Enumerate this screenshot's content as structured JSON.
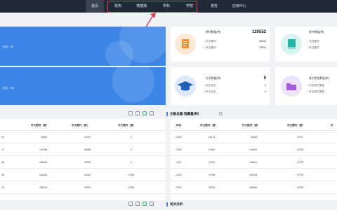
{
  "nav": {
    "items": [
      "首页",
      "机构",
      "数据库",
      "学科",
      "学院",
      "报告",
      "应用中心"
    ],
    "active_index": 0
  },
  "banners": [
    {
      "line": "外文：99"
    },
    {
      "line": "外文：387"
    }
  ],
  "cards": [
    {
      "title": "期刊数量(种)",
      "total": "120552",
      "rows": [
        {
          "label": "• 中文期刊",
          "value": "40933"
        },
        {
          "label": "• 外文期刊",
          "value": "79619"
        }
      ],
      "icon": "book-icon",
      "color": "#fde9d6"
    },
    {
      "title": "图书数量(种)",
      "total": "",
      "rows": [
        {
          "label": "• 中文图书",
          "value": ""
        },
        {
          "label": "• 外文图书",
          "value": ""
        }
      ],
      "icon": "book-closed-icon",
      "color": "#d8f3f0"
    },
    {
      "title": "论文数量(种)",
      "total": "0",
      "rows": [
        {
          "label": "• 中文论文",
          "value": "0"
        },
        {
          "label": "• 外文论文",
          "value": "0"
        }
      ],
      "icon": "graduation-cap-icon",
      "color": "#dce9fb"
    },
    {
      "title": "其它类型数量(种)",
      "total": "",
      "rows": [
        {
          "label": "• 中文其它类型",
          "value": ""
        },
        {
          "label": "• 外文其它类型",
          "value": ""
        }
      ],
      "icon": "folder-icon",
      "color": "#efe3fb"
    }
  ],
  "left_table": {
    "headers": [
      "外文图书（册）",
      "中文期刊（册）",
      "外文期刊（册）"
    ],
    "rows": [
      {
        "c0": "53",
        "c1": "49661",
        "c2": "27870",
        "c3": "0"
      },
      {
        "c0": "71",
        "c1": "144758",
        "c2": "45959",
        "c3": "0"
      },
      {
        "c0": "86",
        "c1": "168239",
        "c2": "45959",
        "c3": "0"
      },
      {
        "c0": "58",
        "c1": "181360",
        "c2": "54320",
        "c3": "17680"
      },
      {
        "c0": "19",
        "c1": "189129",
        "c2": "40933",
        "c3": "17681"
      }
    ]
  },
  "right_section_title": "文献总量-馆藏量(种)",
  "right_table": {
    "headers": [
      "年份",
      "中文图书（册）",
      "外文图书（册）",
      "中文期刊（册）",
      "外"
    ],
    "rows": [
      {
        "c0": "2019",
        "c1": "34174",
        "c2": "49648",
        "c3": "79727"
      },
      {
        "c0": "2020",
        "c1": "37467",
        "c2": "144402",
        "c3": "22790"
      },
      {
        "c0": "2021",
        "c1": "37061",
        "c2": "168021",
        "c3": "22790"
      },
      {
        "c0": "2022",
        "c1": "37998",
        "c2": "181516",
        "c3": "22790"
      },
      {
        "c0": "2023",
        "c1": "35451",
        "c2": "185486",
        "c3": "22496"
      }
    ]
  },
  "bottom_section_title": "发文分析",
  "colors": {
    "nav_bg": "#1f2a36",
    "banner": "#3d86e8",
    "highlight": "#e03b5a"
  }
}
